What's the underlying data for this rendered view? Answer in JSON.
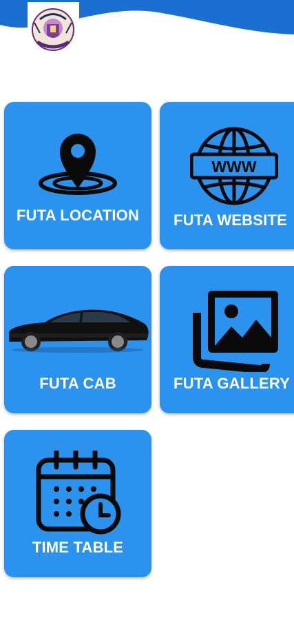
{
  "colors": {
    "tile_background": "#2b92ee",
    "header_wave": "#1a6fd1",
    "icon": "#0a0a0a",
    "label": "#ffffff"
  },
  "header": {
    "logo_icon": "university-crest-icon"
  },
  "tiles": [
    {
      "label": "FUTA LOCATION",
      "icon": "location-pin-icon"
    },
    {
      "label": "FUTA WEBSITE",
      "icon": "globe-www-icon"
    },
    {
      "label": "FUTA CAB",
      "icon": "car-icon"
    },
    {
      "label": "FUTA GALLERY",
      "icon": "photo-gallery-icon"
    },
    {
      "label": "TIME TABLE",
      "icon": "calendar-clock-icon"
    }
  ],
  "website_icon_text": "WWW"
}
